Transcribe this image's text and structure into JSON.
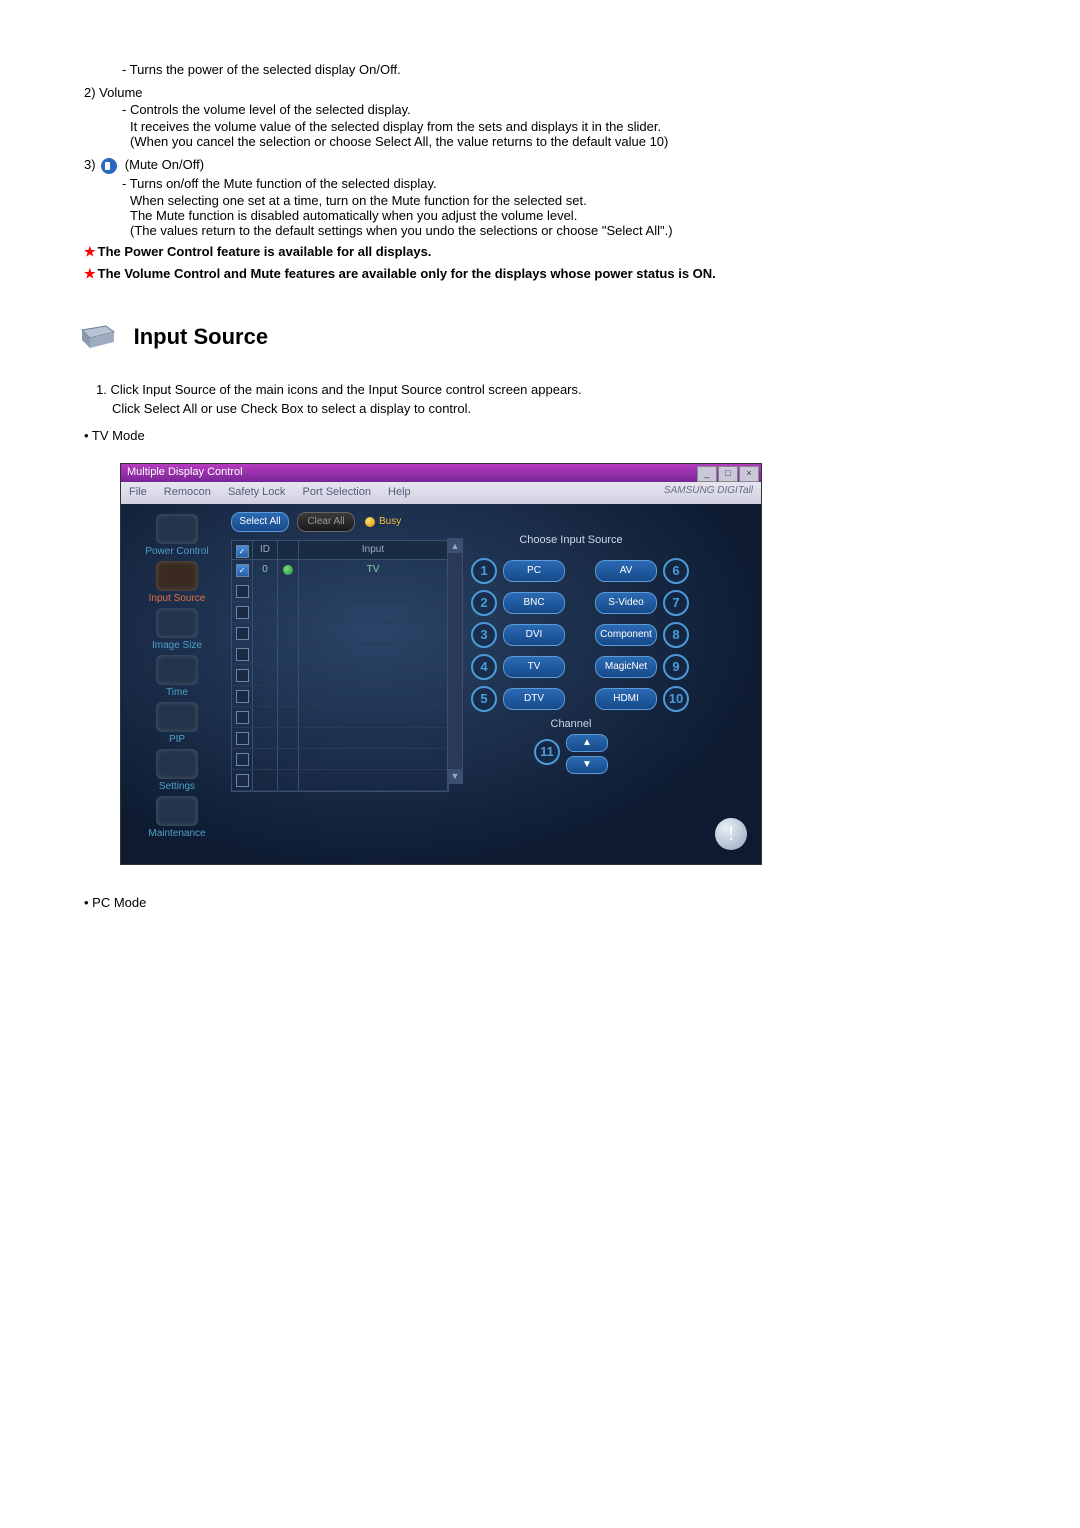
{
  "doc": {
    "line1": "- Turns the power of the selected display On/Off.",
    "item2": "2)  Volume",
    "vol1": "- Controls the volume level of the selected display.",
    "vol2": "It receives the volume value of the selected display from the sets and displays it in the slider.",
    "vol3": "(When you cancel the selection or choose Select All, the value returns to the default value 10)",
    "item3a": "3) ",
    "item3b": " (Mute On/Off)",
    "mute1": "- Turns on/off the Mute function of the selected display.",
    "mute2": "When selecting one set at a time, turn on the Mute function for the selected set.",
    "mute3": "The Mute function is disabled automatically when you adjust the volume level.",
    "mute4": "(The values return to the default settings when you undo the selections or choose \"Select All\".)",
    "note1": "The Power Control feature is available for all displays.",
    "note2": "The Volume Control and Mute features are available only for the displays whose power status is ON.",
    "heading": "Input Source",
    "step1": "1.  Click Input Source of the main icons and the Input Source control screen appears.",
    "step1b": "Click Select All or use Check Box to select a display to control.",
    "bullet_tv": "• TV Mode",
    "bullet_pc": "• PC Mode"
  },
  "shot": {
    "title": "Multiple Display Control",
    "menu": [
      "File",
      "Remocon",
      "Safety Lock",
      "Port Selection",
      "Help"
    ],
    "brand": "SAMSUNG DIGITall",
    "sidebar": [
      {
        "label": "Power Control"
      },
      {
        "label": "Input Source"
      },
      {
        "label": "Image Size"
      },
      {
        "label": "Time"
      },
      {
        "label": "PIP"
      },
      {
        "label": "Settings"
      },
      {
        "label": "Maintenance"
      }
    ],
    "btn_select_all": "Select All",
    "btn_clear_all": "Clear All",
    "busy": "Busy",
    "grid_headers": {
      "c1": "",
      "c2": "ID",
      "c3": "",
      "c4": "Input"
    },
    "row0": {
      "id": "0",
      "input": "TV"
    },
    "right_title": "Choose Input Source",
    "sources_left": [
      {
        "n": "1",
        "label": "PC"
      },
      {
        "n": "2",
        "label": "BNC"
      },
      {
        "n": "3",
        "label": "DVI"
      },
      {
        "n": "4",
        "label": "TV"
      },
      {
        "n": "5",
        "label": "DTV"
      }
    ],
    "sources_right": [
      {
        "n": "6",
        "label": "AV"
      },
      {
        "n": "7",
        "label": "S-Video"
      },
      {
        "n": "8",
        "label": "Component"
      },
      {
        "n": "9",
        "label": "MagicNet"
      },
      {
        "n": "10",
        "label": "HDMI"
      }
    ],
    "channel_label": "Channel",
    "channel_badge": "11",
    "ch_up": "▲",
    "ch_dn": "▼",
    "info": "!"
  }
}
